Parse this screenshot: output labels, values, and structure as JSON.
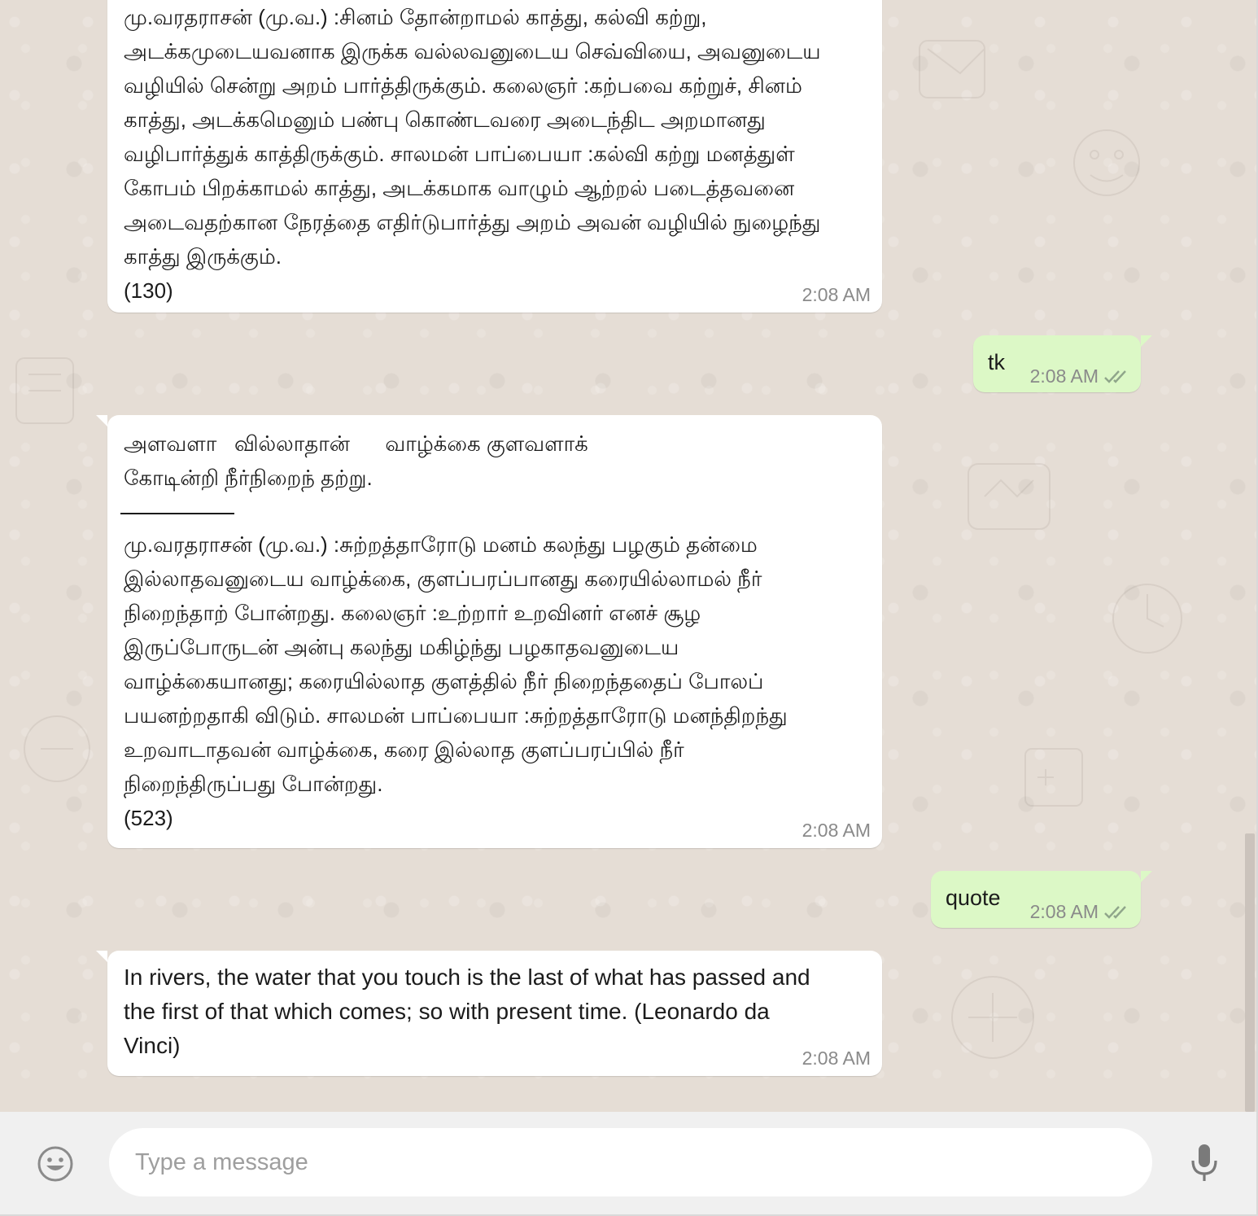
{
  "messages": [
    {
      "direction": "incoming",
      "text": "மு.வரதராசன் (மு.வ.) :சினம் தோன்றாமல் காத்து, கல்வி கற்று,\nஅடக்கமுடையவனாக இருக்க வல்லவனுடைய செவ்வியை, அவனுடைய\nவழியில் சென்று அறம் பார்த்திருக்கும். கலைஞர் :கற்பவை கற்றுச், சினம்\nகாத்து, அடக்கமெனும் பண்பு கொண்டவரை அடைந்திட அறமானது\nவழிபார்த்துக் காத்திருக்கும். சாலமன் பாப்பையா :கல்வி கற்று மனத்துள்\nகோபம் பிறக்காமல் காத்து, அடக்கமாக வாழும் ஆற்றல் படைத்தவனை\nஅடைவதற்கான நேரத்தை எதிர்டுபார்த்து அறம் அவன் வழியில் நுழைந்து\nகாத்து இருக்கும்.\n(130)",
      "time": "2:08 AM"
    },
    {
      "direction": "outgoing",
      "text": "tk",
      "time": "2:08 AM",
      "status": "read-double-check"
    },
    {
      "direction": "incoming",
      "kural_line1": "அளவளா   வில்லாதான்      வாழ்க்கை குளவளாக்",
      "kural_line2": "கோடின்றி நீர்நிறைந் தற்று.",
      "text": "மு.வரதராசன் (மு.வ.) :சுற்றத்தாரோடு மனம் கலந்து பழகும் தன்மை\nஇல்லாதவனுடைய வாழ்க்கை, குளப்பரப்பானது கரையில்லாமல் நீர்\nநிறைந்தாற் போன்றது. கலைஞர் :உற்றார் உறவினர் எனச் சூழ\nஇருப்போருடன் அன்பு கலந்து மகிழ்ந்து பழகாதவனுடைய\nவாழ்க்கையானது; கரையில்லாத குளத்தில் நீர் நிறைந்ததைப் போலப்\nபயனற்றதாகி விடும். சாலமன் பாப்பையா :சுற்றத்தாரோடு மனந்திறந்து\nஉறவாடாதவன் வாழ்க்கை, கரை இல்லாத குளப்பரப்பில் நீர்\nநிறைந்திருப்பது போன்றது.\n(523)",
      "time": "2:08 AM"
    },
    {
      "direction": "outgoing",
      "text": "quote",
      "time": "2:08 AM",
      "status": "read-double-check"
    },
    {
      "direction": "incoming",
      "text": "In rivers, the water that you touch is the last of what has passed and\nthe first of that which comes; so with present time. (Leonardo da\nVinci)",
      "time": "2:08 AM"
    }
  ],
  "compose": {
    "placeholder": "Type a message",
    "emoji_icon": "smiley-icon",
    "mic_icon": "microphone-icon"
  },
  "colors": {
    "chat_background": "#e5ddd5",
    "incoming_bubble": "#ffffff",
    "outgoing_bubble": "#dcf8c6",
    "read_ticks": "#8fa58a",
    "compose_bar": "#f0f0f0"
  }
}
